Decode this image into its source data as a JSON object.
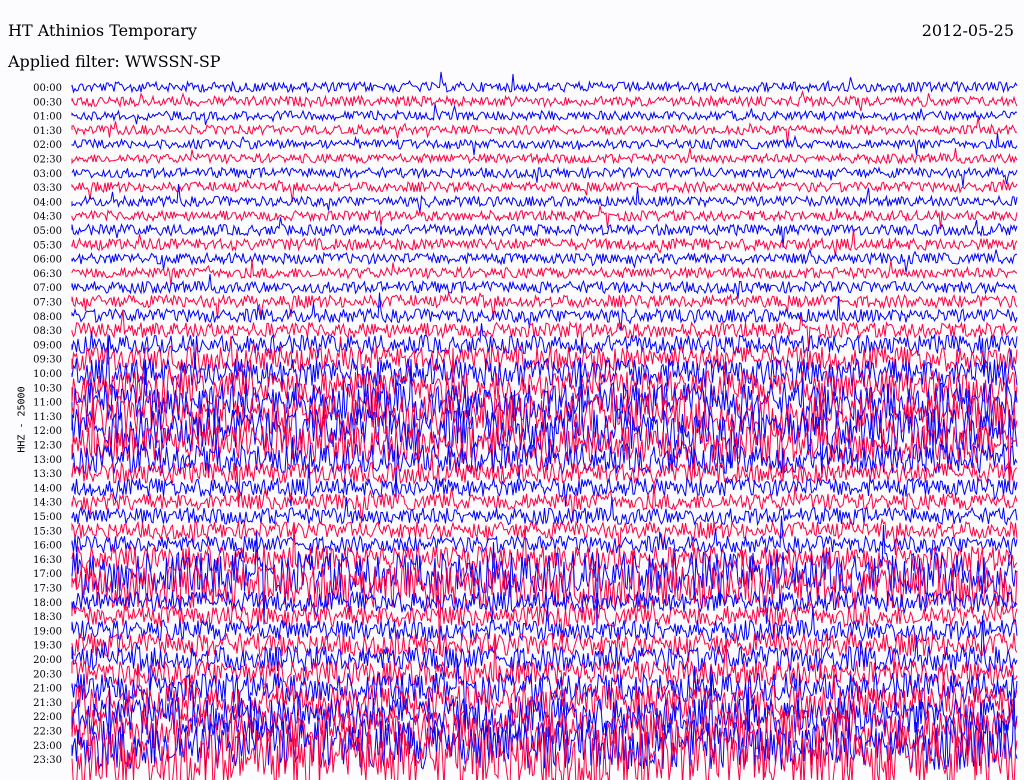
{
  "header": {
    "station": "HT Athinios Temporary",
    "date": "2012-05-25",
    "filter": "Applied filter: WWSSN-SP"
  },
  "chart_data": {
    "type": "line",
    "title": "HT Athinios Temporary",
    "subtitle": "Applied filter: WWSSN-SP",
    "ylabel": "HHZ - 25000",
    "xlabel": "",
    "row_labels": [
      "00:00",
      "00:30",
      "01:00",
      "01:30",
      "02:00",
      "02:30",
      "03:00",
      "03:30",
      "04:00",
      "04:30",
      "05:00",
      "05:30",
      "06:00",
      "06:30",
      "07:00",
      "07:30",
      "08:00",
      "08:30",
      "09:00",
      "09:30",
      "10:00",
      "10:30",
      "11:00",
      "11:30",
      "12:00",
      "12:30",
      "13:00",
      "13:30",
      "14:00",
      "14:30",
      "15:00",
      "15:30",
      "16:00",
      "16:30",
      "17:00",
      "17:30",
      "18:00",
      "18:30",
      "19:00",
      "19:30",
      "20:00",
      "20:30",
      "21:00",
      "21:30",
      "22:00",
      "22:30",
      "23:00",
      "23:30"
    ],
    "series_colors": [
      "#0000ff",
      "#ff0040"
    ],
    "relative_amplitude": [
      1.2,
      1.2,
      1.1,
      1.1,
      1.1,
      1.1,
      1.2,
      1.2,
      1.2,
      1.2,
      1.3,
      1.4,
      1.3,
      1.3,
      1.4,
      1.5,
      1.6,
      1.8,
      2.2,
      3,
      3.5,
      4,
      4.5,
      5,
      5,
      4.5,
      3.5,
      2.5,
      2.2,
      2,
      2,
      2,
      2,
      3,
      5,
      5,
      2.5,
      2.5,
      2.5,
      2.8,
      3,
      3,
      3.5,
      4,
      4.5,
      5,
      6,
      7
    ],
    "grid": false,
    "legend": "none"
  }
}
